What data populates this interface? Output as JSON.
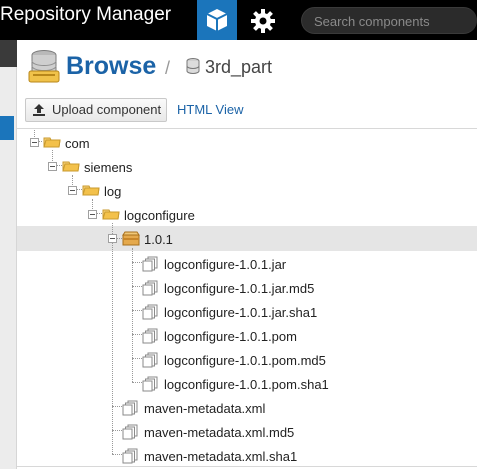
{
  "topbar": {
    "app_title": "Repository Manager",
    "browse_icon": "cube-icon",
    "settings_icon": "gear-icon",
    "search_placeholder": "Search components"
  },
  "header": {
    "title": "Browse",
    "separator": "/",
    "repository": "3rd_part"
  },
  "toolbar": {
    "upload_label": "Upload component",
    "html_view_label": "HTML View"
  },
  "tree": {
    "com": "com",
    "siemens": "siemens",
    "log": "log",
    "logconfigure": "logconfigure",
    "version": "1.0.1",
    "files": [
      "logconfigure-1.0.1.jar",
      "logconfigure-1.0.1.jar.md5",
      "logconfigure-1.0.1.jar.sha1",
      "logconfigure-1.0.1.pom",
      "logconfigure-1.0.1.pom.md5",
      "logconfigure-1.0.1.pom.sha1"
    ],
    "metadata": [
      "maven-metadata.xml",
      "maven-metadata.xml.md5",
      "maven-metadata.xml.sha1"
    ]
  },
  "colors": {
    "brand_blue": "#1b75bb",
    "title_blue": "#1b63a7",
    "folder": "#f3c14b",
    "selected_row": "#e5e5e5"
  }
}
